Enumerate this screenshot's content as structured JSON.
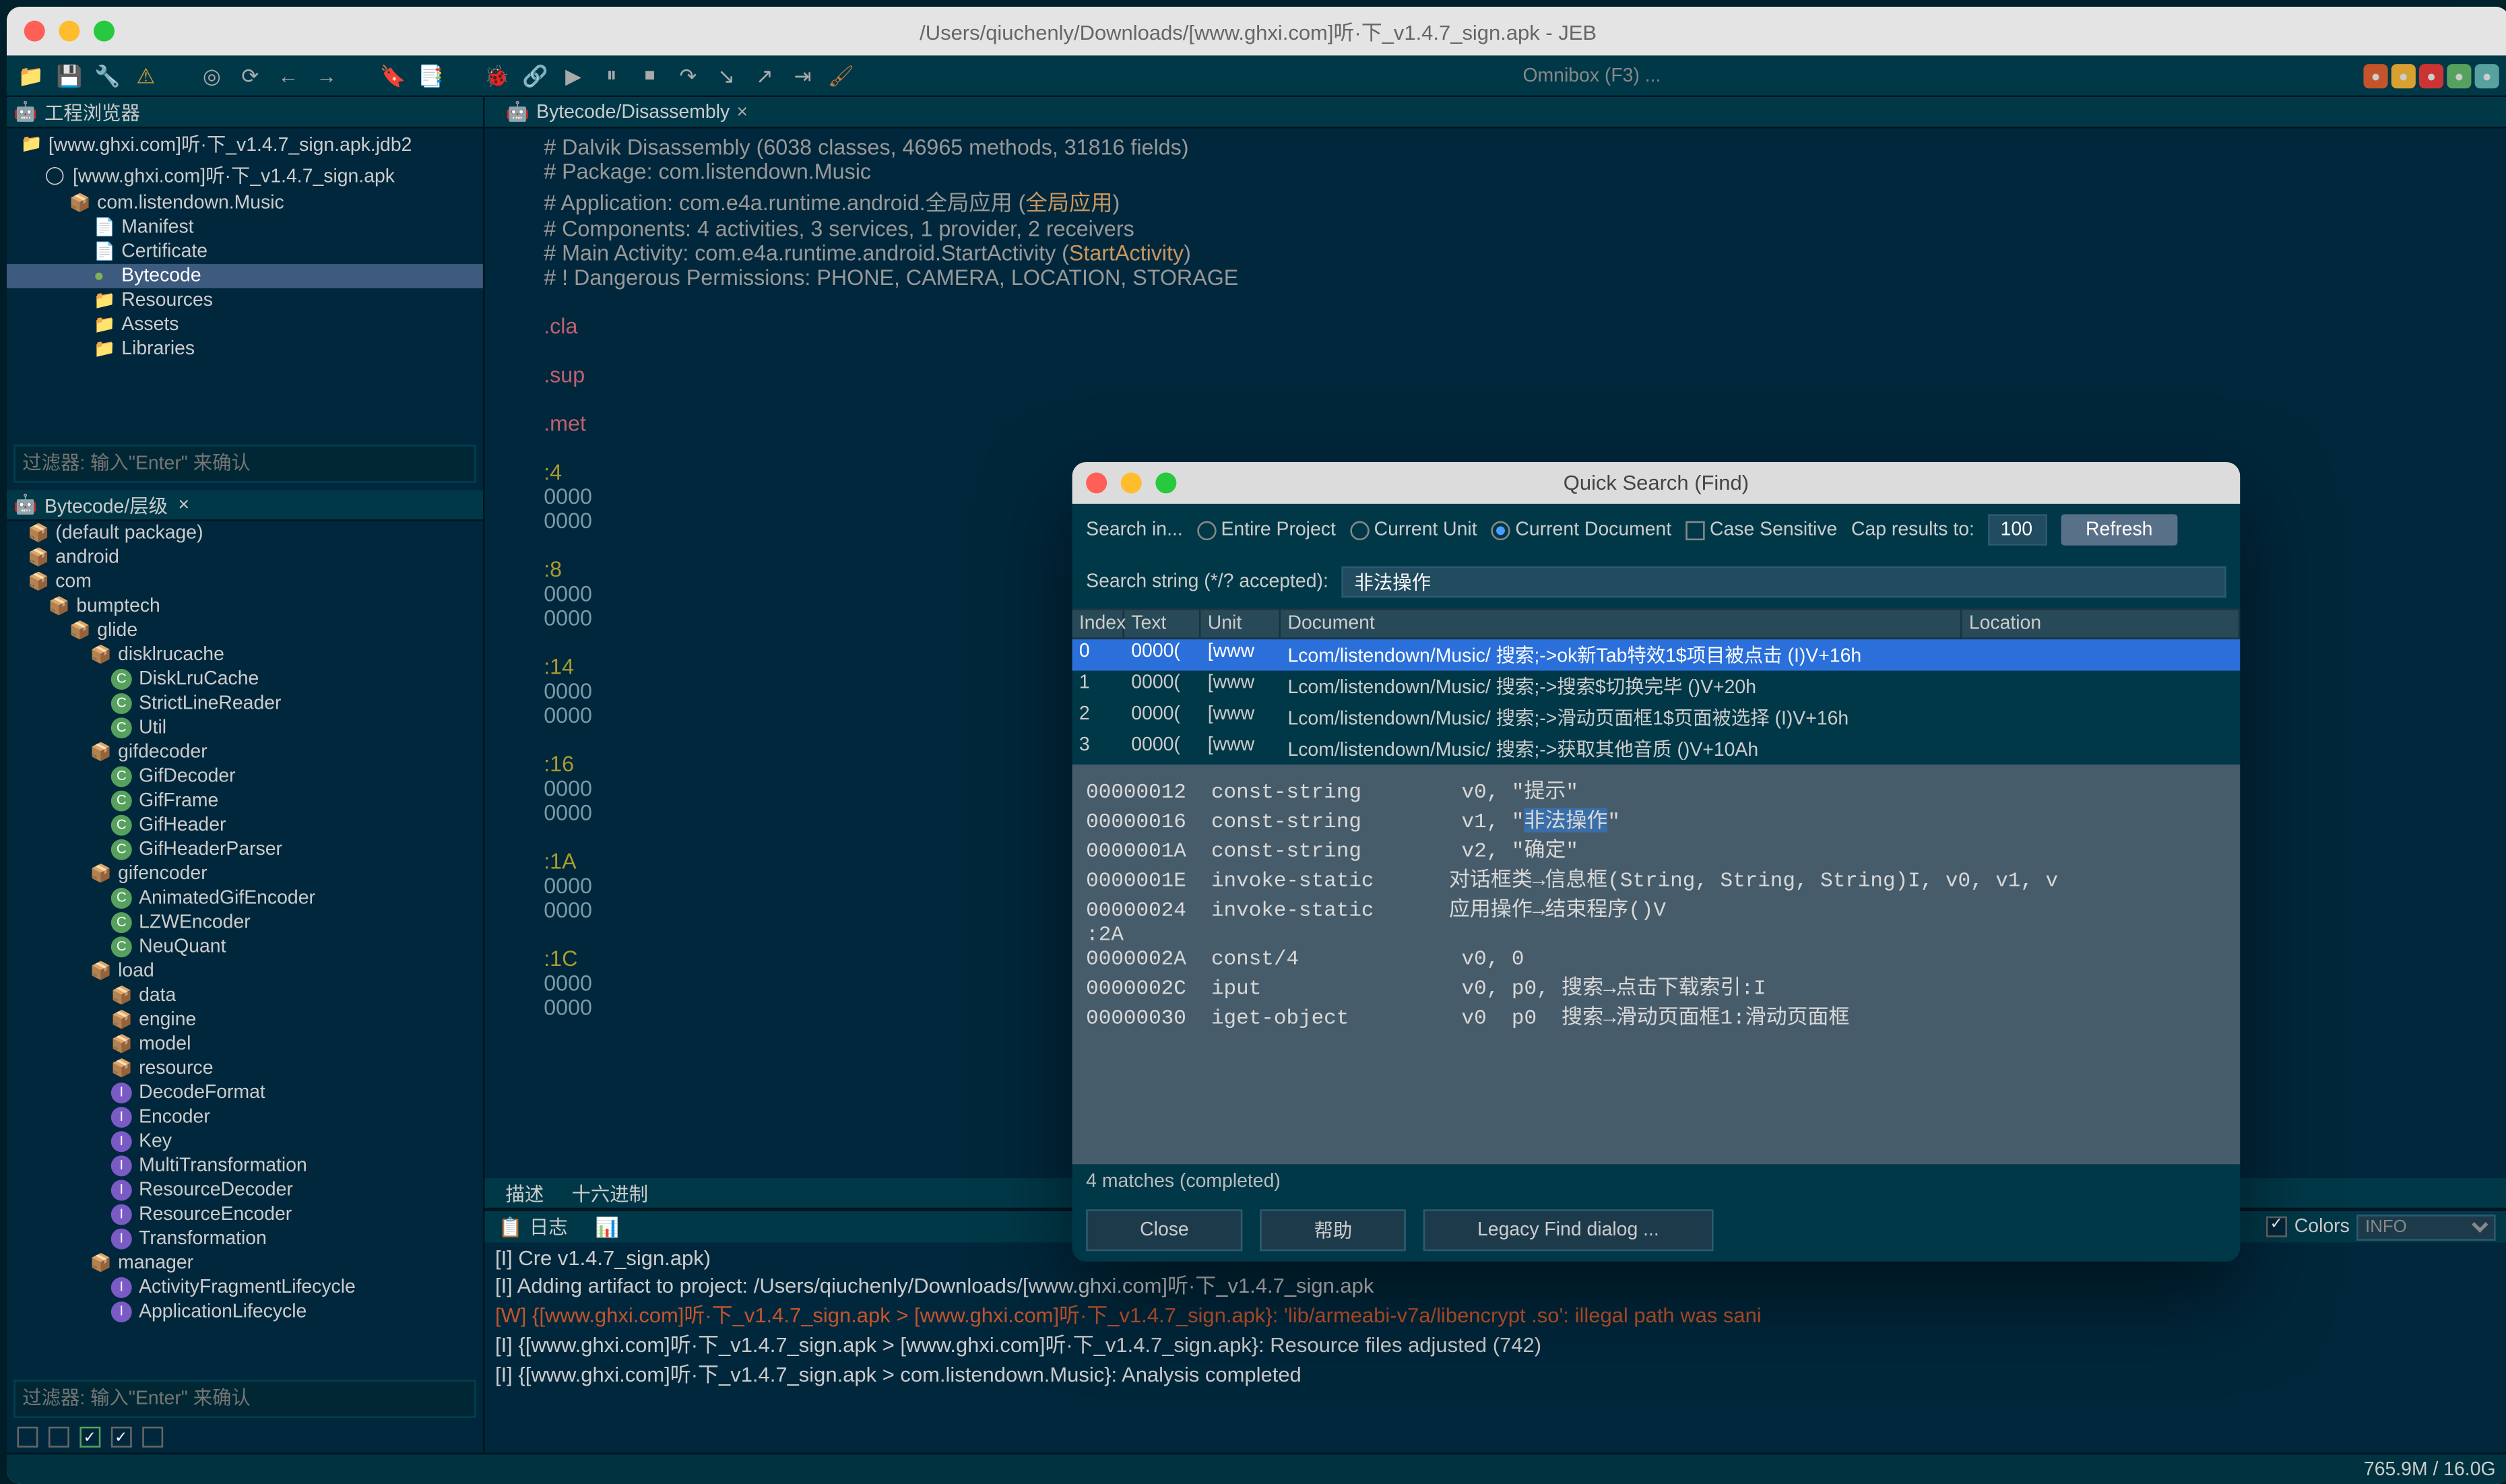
{
  "window": {
    "title": "/Users/qiuchenly/Downloads/[www.ghxi.com]听·下_v1.4.7_sign.apk - JEB"
  },
  "omnibox": {
    "hint": "Omnibox (F3) ..."
  },
  "left": {
    "project_panel_title": "工程浏览器",
    "tree": [
      {
        "depth": 0,
        "icon": "📁",
        "label": "[www.ghxi.com]听·下_v1.4.7_sign.apk.jdb2"
      },
      {
        "depth": 1,
        "icon": "◯",
        "label": "[www.ghxi.com]听·下_v1.4.7_sign.apk"
      },
      {
        "depth": 2,
        "icon": "📦",
        "label": "com.listendown.Music"
      },
      {
        "depth": 3,
        "icon": "📄",
        "label": "Manifest"
      },
      {
        "depth": 3,
        "icon": "📄",
        "label": "Certificate"
      },
      {
        "depth": 3,
        "icon": "●",
        "label": "Bytecode",
        "selected": true
      },
      {
        "depth": 3,
        "icon": "📁",
        "label": "Resources"
      },
      {
        "depth": 3,
        "icon": "📁",
        "label": "Assets"
      },
      {
        "depth": 3,
        "icon": "📁",
        "label": "Libraries"
      }
    ],
    "filter_placeholder": "过滤器: 输入\"Enter\" 来确认",
    "hierarchy_tab": "Bytecode/层级",
    "hierarchy": [
      {
        "depth": 0,
        "icon": "📦",
        "label": "(default package)"
      },
      {
        "depth": 0,
        "icon": "📦",
        "label": "android"
      },
      {
        "depth": 0,
        "icon": "📦",
        "label": "com"
      },
      {
        "depth": 1,
        "icon": "📦",
        "label": "bumptech"
      },
      {
        "depth": 2,
        "icon": "📦",
        "label": "glide"
      },
      {
        "depth": 3,
        "icon": "📦",
        "label": "disklrucache"
      },
      {
        "depth": 4,
        "icon": "C",
        "label": "DiskLruCache"
      },
      {
        "depth": 4,
        "icon": "C",
        "label": "StrictLineReader"
      },
      {
        "depth": 4,
        "icon": "C",
        "label": "Util"
      },
      {
        "depth": 3,
        "icon": "📦",
        "label": "gifdecoder"
      },
      {
        "depth": 4,
        "icon": "C",
        "label": "GifDecoder"
      },
      {
        "depth": 4,
        "icon": "C",
        "label": "GifFrame"
      },
      {
        "depth": 4,
        "icon": "C",
        "label": "GifHeader"
      },
      {
        "depth": 4,
        "icon": "C",
        "label": "GifHeaderParser"
      },
      {
        "depth": 3,
        "icon": "📦",
        "label": "gifencoder"
      },
      {
        "depth": 4,
        "icon": "C",
        "label": "AnimatedGifEncoder"
      },
      {
        "depth": 4,
        "icon": "C",
        "label": "LZWEncoder"
      },
      {
        "depth": 4,
        "icon": "C",
        "label": "NeuQuant"
      },
      {
        "depth": 3,
        "icon": "📦",
        "label": "load"
      },
      {
        "depth": 4,
        "icon": "📦",
        "label": "data"
      },
      {
        "depth": 4,
        "icon": "📦",
        "label": "engine"
      },
      {
        "depth": 4,
        "icon": "📦",
        "label": "model"
      },
      {
        "depth": 4,
        "icon": "📦",
        "label": "resource"
      },
      {
        "depth": 4,
        "icon": "I",
        "label": "DecodeFormat"
      },
      {
        "depth": 4,
        "icon": "I",
        "label": "Encoder"
      },
      {
        "depth": 4,
        "icon": "I",
        "label": "Key"
      },
      {
        "depth": 4,
        "icon": "I",
        "label": "MultiTransformation"
      },
      {
        "depth": 4,
        "icon": "I",
        "label": "ResourceDecoder"
      },
      {
        "depth": 4,
        "icon": "I",
        "label": "ResourceEncoder"
      },
      {
        "depth": 4,
        "icon": "I",
        "label": "Transformation"
      },
      {
        "depth": 3,
        "icon": "📦",
        "label": "manager"
      },
      {
        "depth": 4,
        "icon": "I",
        "label": "ActivityFragmentLifecycle"
      },
      {
        "depth": 4,
        "icon": "I",
        "label": "ApplicationLifecycle"
      }
    ]
  },
  "main": {
    "tab_title": "Bytecode/Disassembly",
    "code_header": [
      "# Dalvik Disassembly (6038 classes, 46965 methods, 31816 fields)",
      "# Package: com.listendown.Music",
      "# Application: com.e4a.runtime.android.全局应用 (全局应用)",
      "# Components: 4 activities, 3 services, 1 provider, 2 receivers",
      "# Main Activity: com.e4a.runtime.android.StartActivity (StartActivity)",
      "# ! Dangerous Permissions: PHONE, CAMERA, LOCATION, STORAGE"
    ],
    "partial_lines": [
      ".cla",
      ".sup",
      ".met"
    ],
    "line_labels": [
      ":4",
      ":8",
      ":14",
      ":16",
      ":1A",
      ":1C"
    ],
    "bottom_tabs": [
      "描述",
      "十六进制"
    ]
  },
  "dialog": {
    "title": "Quick Search (Find)",
    "search_in": "Search in...",
    "opt_entire": "Entire Project",
    "opt_current_unit": "Current Unit",
    "opt_current_doc": "Current Document",
    "case_sensitive": "Case Sensitive",
    "cap_label": "Cap results to:",
    "cap_value": "100",
    "refresh": "Refresh",
    "string_label": "Search string (*/? accepted):",
    "string_value": "非法操作",
    "columns": {
      "index": "Index",
      "text": "Text",
      "unit": "Unit",
      "document": "Document",
      "location": "Location"
    },
    "rows": [
      {
        "i": "0",
        "text": "0000(",
        "unit": "[www",
        "doc": "Lcom/listendown/Music/ 搜索;->ok新Tab特效1$项目被点击 (I)V+16h",
        "sel": true
      },
      {
        "i": "1",
        "text": "0000(",
        "unit": "[www",
        "doc": "Lcom/listendown/Music/ 搜索;->搜索$切换完毕 ()V+20h"
      },
      {
        "i": "2",
        "text": "0000(",
        "unit": "[www",
        "doc": "Lcom/listendown/Music/ 搜索;->滑动页面框1$页面被选择 (I)V+16h"
      },
      {
        "i": "3",
        "text": "0000(",
        "unit": "[www",
        "doc": "Lcom/listendown/Music/ 搜索;->获取其他音质 ()V+10Ah"
      }
    ],
    "preview": [
      "00000012  const-string        v0, \"提示\"",
      "00000016  const-string        v1, \"非法操作\"",
      "0000001A  const-string        v2, \"确定\"",
      "0000001E  invoke-static      对话框类→信息框(String, String, String)I, v0, v1, v",
      "00000024  invoke-static      应用操作→结束程序()V",
      ":2A",
      "0000002A  const/4             v0, 0",
      "0000002C  iput                v0, p0, 搜索→点击下载索引:I",
      "00000030  iget-object         v0  p0  搜索→滑动页面框1:滑动页面框"
    ],
    "matches": "4 matches (completed)",
    "close": "Close",
    "help": "帮助",
    "legacy": "Legacy Find dialog ..."
  },
  "log": {
    "tab1": "日志",
    "lines": [
      {
        "t": "[I] Cre                                                                                              v1.4.7_sign.apk)"
      },
      {
        "t": "[I] Adding artifact to project: /Users/qiuchenly/Downloads/[www.ghxi.com]听·下_v1.4.7_sign.apk"
      },
      {
        "t": "[W] {[www.ghxi.com]听·下_v1.4.7_sign.apk > [www.ghxi.com]听·下_v1.4.7_sign.apk}: 'lib/armeabi-v7a/libencrypt .so': illegal path was sani",
        "warn": true
      },
      {
        "t": "[I] {[www.ghxi.com]听·下_v1.4.7_sign.apk > [www.ghxi.com]听·下_v1.4.7_sign.apk}: Resource files adjusted (742)"
      },
      {
        "t": "[I] {[www.ghxi.com]听·下_v1.4.7_sign.apk > com.listendown.Music}: Analysis completed"
      }
    ],
    "colors_label": "Colors",
    "level": "INFO"
  },
  "status": {
    "memory": "765.9M / 16.0G"
  }
}
